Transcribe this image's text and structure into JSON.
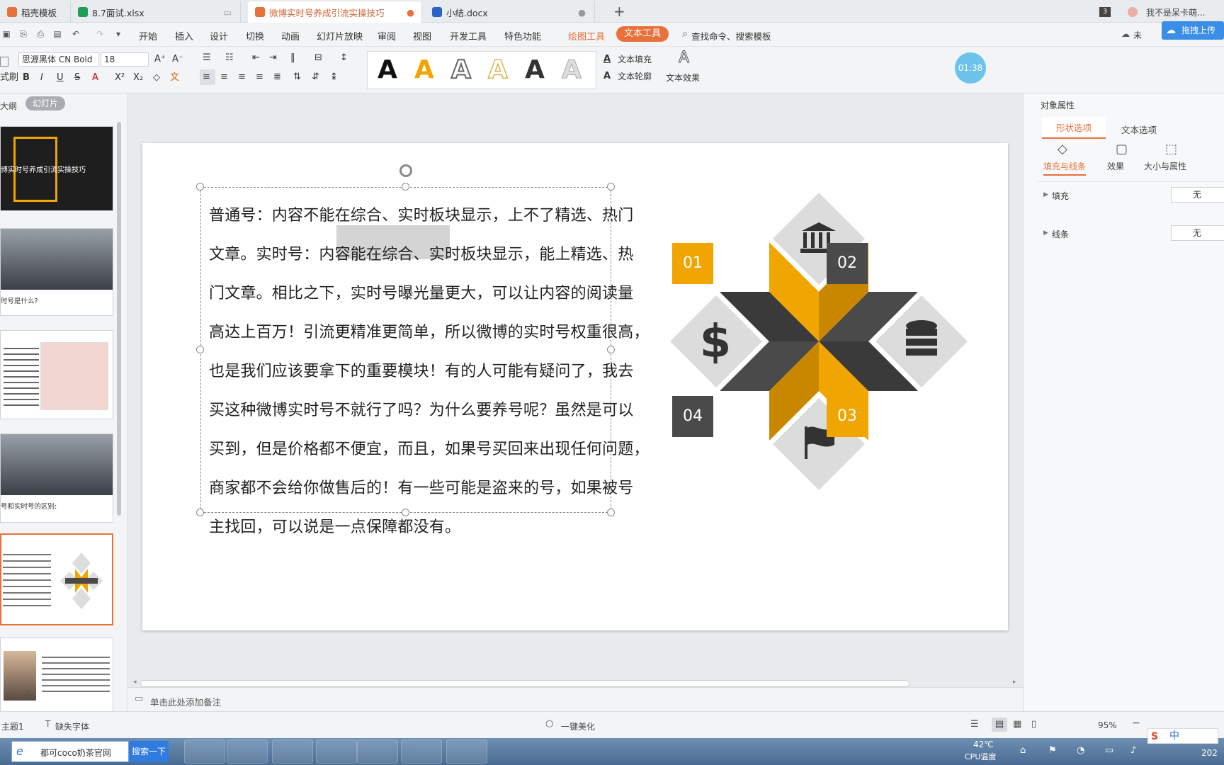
{
  "tabs": [
    {
      "label": "稻壳模板",
      "icon": "daoke-icon",
      "color": "#e8703a"
    },
    {
      "label": "8.7面试.xlsx",
      "icon": "spreadsheet-icon",
      "color": "#1f9d55"
    },
    {
      "label": "微博实时号养成引流实操技巧",
      "icon": "presentation-icon",
      "color": "#e8703a"
    },
    {
      "label": "小结.docx",
      "icon": "document-icon",
      "color": "#2b63c6"
    }
  ],
  "window": {
    "count_badge": "3",
    "user": "我不是呆卡萌...",
    "upload": "拖拽上传",
    "sync": "未"
  },
  "menu": [
    "开始",
    "插入",
    "设计",
    "切换",
    "动画",
    "幻灯片放映",
    "审阅",
    "视图",
    "开发工具",
    "特色功能"
  ],
  "menu_context": {
    "drawing_tools": "绘图工具",
    "text_tools": "文本工具"
  },
  "search": {
    "label": "查找命令、搜索模板"
  },
  "ribbon": {
    "format_painter": "式刷",
    "font_name": "思源黑体 CN Bold",
    "font_size": "18",
    "text_fill": "文本填充",
    "text_outline": "文本轮廓",
    "text_effect": "文本效果",
    "timer": "01:38"
  },
  "leftpane": {
    "tab_outline": "大纲",
    "tab_slides": "幻灯片",
    "thumbs": [
      {
        "caption": "博实时号养成引流实操技巧"
      },
      {
        "caption": "时号是什么?"
      },
      {
        "caption": ""
      },
      {
        "caption": "号和实时号的区别:"
      },
      {
        "caption": ""
      },
      {
        "caption": ""
      }
    ]
  },
  "slide": {
    "lines": [
      "普通号：内容不能在综合、实时板块显示，上不了精选、热门",
      "文章。实时号：内容能在综合、实时板块显示，能上精选、热",
      "门文章。相比之下，实时号曝光量更大，可以让内容的阅读量",
      "高达上百万！引流更精准更简单，所以微博的实时号权重很高，",
      "也是我们应该要拿下的重要模块！有的人可能有疑问了，我去",
      "买这种微博实时号不就行了吗？为什么要养号呢？虽然是可以",
      "买到，但是价格都不便宜，而且，如果号买回来出现任何问题，",
      "商家都不会给你做售后的！有一些可能是盗来的号，如果被号",
      "主找回，可以说是一点保障都没有。"
    ],
    "infographic": {
      "labels": [
        "01",
        "02",
        "03",
        "04"
      ],
      "icons": [
        "bank-icon",
        "database-icon",
        "flag-icon",
        "dollar-icon"
      ],
      "colors": {
        "gold": "#f0a500",
        "dark": "#4a4a4a",
        "gray": "#dcdcdc"
      }
    }
  },
  "notes": {
    "placeholder": "单击此处添加备注"
  },
  "rightpane": {
    "title": "对象属性",
    "tab_shape": "形状选项",
    "tab_text": "文本选项",
    "sub_fill_line": "填充与线条",
    "sub_effect": "效果",
    "sub_size": "大小与属性",
    "fill_label": "填充",
    "fill_value": "无",
    "line_label": "线条",
    "line_value": "无"
  },
  "status": {
    "theme": "主题1",
    "missing_font": "缺失字体",
    "beautify": "一键美化",
    "zoom": "95%"
  },
  "taskbar": {
    "ie_text": "都可coco奶茶官网",
    "search_btn": "搜索一下",
    "temp": "42℃",
    "temp_label": "CPU温度",
    "ime": "中",
    "year": "202"
  }
}
